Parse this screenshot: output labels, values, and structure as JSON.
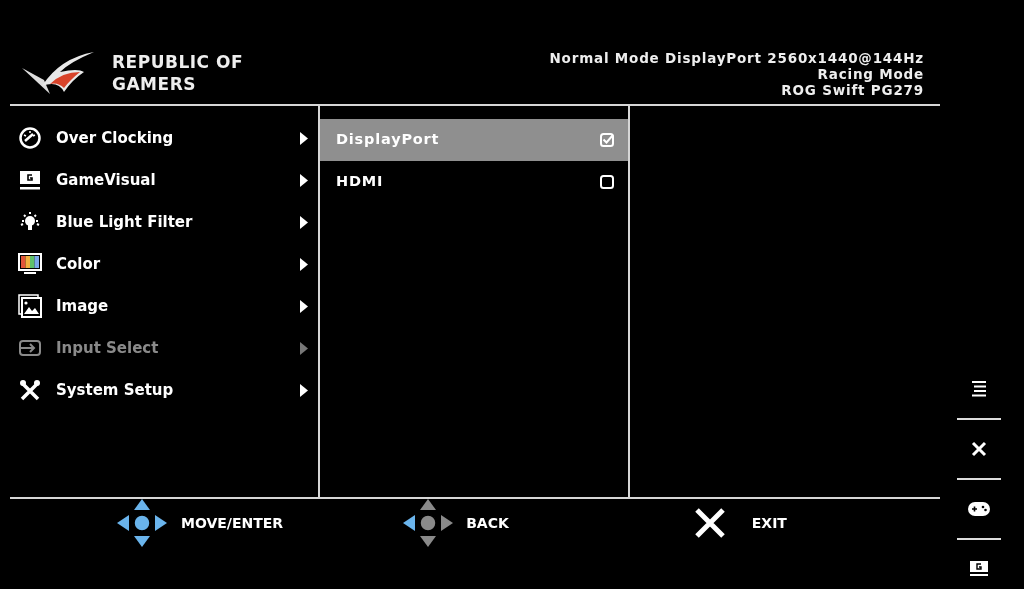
{
  "logo": {
    "lines": [
      "REPUBLIC OF",
      "GAMERS"
    ]
  },
  "status": [
    "Normal Mode DisplayPort 2560x1440@144Hz",
    "Racing Mode",
    "ROG Swift PG279"
  ],
  "menu": [
    {
      "kind": "gauge",
      "label": "Over Clocking",
      "selected": false
    },
    {
      "kind": "gamevisual",
      "label": "GameVisual",
      "selected": false
    },
    {
      "kind": "bulb",
      "label": "Blue Light Filter",
      "selected": false
    },
    {
      "kind": "color",
      "label": "Color",
      "selected": false
    },
    {
      "kind": "image",
      "label": "Image",
      "selected": false
    },
    {
      "kind": "input",
      "label": "Input Select",
      "selected": true
    },
    {
      "kind": "tools",
      "label": "System Setup",
      "selected": false
    }
  ],
  "submenu": [
    {
      "label": "DisplayPort",
      "selected": true,
      "checked": true
    },
    {
      "label": "HDMI",
      "selected": false,
      "checked": false
    }
  ],
  "legend": [
    {
      "kind": "move",
      "label": "MOVE/ENTER"
    },
    {
      "kind": "back",
      "label": "BACK"
    },
    {
      "kind": "exit",
      "label": "EXIT"
    }
  ]
}
